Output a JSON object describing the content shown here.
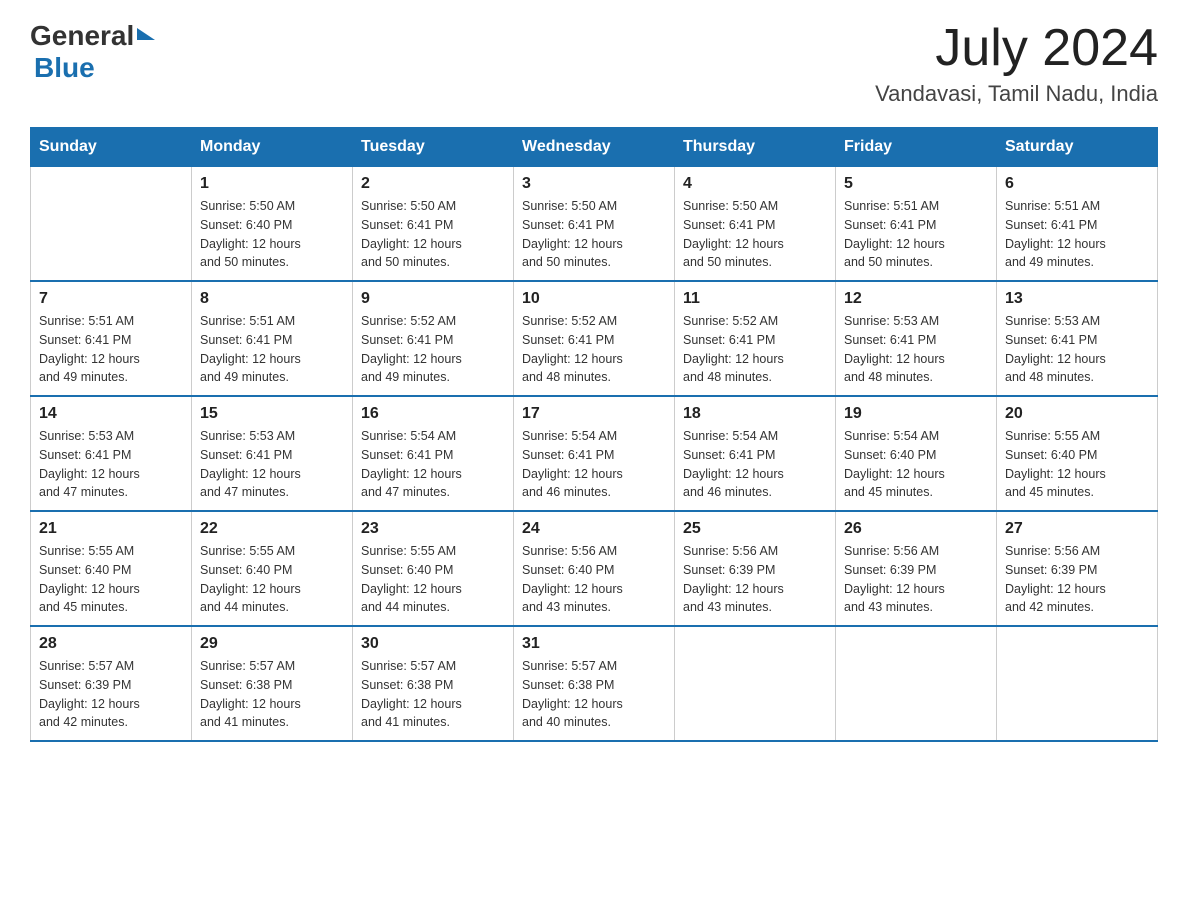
{
  "header": {
    "logo_general": "General",
    "logo_blue": "Blue",
    "month_title": "July 2024",
    "location": "Vandavasi, Tamil Nadu, India"
  },
  "calendar": {
    "days_of_week": [
      "Sunday",
      "Monday",
      "Tuesday",
      "Wednesday",
      "Thursday",
      "Friday",
      "Saturday"
    ],
    "weeks": [
      [
        {
          "day": "",
          "info": ""
        },
        {
          "day": "1",
          "info": "Sunrise: 5:50 AM\nSunset: 6:40 PM\nDaylight: 12 hours\nand 50 minutes."
        },
        {
          "day": "2",
          "info": "Sunrise: 5:50 AM\nSunset: 6:41 PM\nDaylight: 12 hours\nand 50 minutes."
        },
        {
          "day": "3",
          "info": "Sunrise: 5:50 AM\nSunset: 6:41 PM\nDaylight: 12 hours\nand 50 minutes."
        },
        {
          "day": "4",
          "info": "Sunrise: 5:50 AM\nSunset: 6:41 PM\nDaylight: 12 hours\nand 50 minutes."
        },
        {
          "day": "5",
          "info": "Sunrise: 5:51 AM\nSunset: 6:41 PM\nDaylight: 12 hours\nand 50 minutes."
        },
        {
          "day": "6",
          "info": "Sunrise: 5:51 AM\nSunset: 6:41 PM\nDaylight: 12 hours\nand 49 minutes."
        }
      ],
      [
        {
          "day": "7",
          "info": "Sunrise: 5:51 AM\nSunset: 6:41 PM\nDaylight: 12 hours\nand 49 minutes."
        },
        {
          "day": "8",
          "info": "Sunrise: 5:51 AM\nSunset: 6:41 PM\nDaylight: 12 hours\nand 49 minutes."
        },
        {
          "day": "9",
          "info": "Sunrise: 5:52 AM\nSunset: 6:41 PM\nDaylight: 12 hours\nand 49 minutes."
        },
        {
          "day": "10",
          "info": "Sunrise: 5:52 AM\nSunset: 6:41 PM\nDaylight: 12 hours\nand 48 minutes."
        },
        {
          "day": "11",
          "info": "Sunrise: 5:52 AM\nSunset: 6:41 PM\nDaylight: 12 hours\nand 48 minutes."
        },
        {
          "day": "12",
          "info": "Sunrise: 5:53 AM\nSunset: 6:41 PM\nDaylight: 12 hours\nand 48 minutes."
        },
        {
          "day": "13",
          "info": "Sunrise: 5:53 AM\nSunset: 6:41 PM\nDaylight: 12 hours\nand 48 minutes."
        }
      ],
      [
        {
          "day": "14",
          "info": "Sunrise: 5:53 AM\nSunset: 6:41 PM\nDaylight: 12 hours\nand 47 minutes."
        },
        {
          "day": "15",
          "info": "Sunrise: 5:53 AM\nSunset: 6:41 PM\nDaylight: 12 hours\nand 47 minutes."
        },
        {
          "day": "16",
          "info": "Sunrise: 5:54 AM\nSunset: 6:41 PM\nDaylight: 12 hours\nand 47 minutes."
        },
        {
          "day": "17",
          "info": "Sunrise: 5:54 AM\nSunset: 6:41 PM\nDaylight: 12 hours\nand 46 minutes."
        },
        {
          "day": "18",
          "info": "Sunrise: 5:54 AM\nSunset: 6:41 PM\nDaylight: 12 hours\nand 46 minutes."
        },
        {
          "day": "19",
          "info": "Sunrise: 5:54 AM\nSunset: 6:40 PM\nDaylight: 12 hours\nand 45 minutes."
        },
        {
          "day": "20",
          "info": "Sunrise: 5:55 AM\nSunset: 6:40 PM\nDaylight: 12 hours\nand 45 minutes."
        }
      ],
      [
        {
          "day": "21",
          "info": "Sunrise: 5:55 AM\nSunset: 6:40 PM\nDaylight: 12 hours\nand 45 minutes."
        },
        {
          "day": "22",
          "info": "Sunrise: 5:55 AM\nSunset: 6:40 PM\nDaylight: 12 hours\nand 44 minutes."
        },
        {
          "day": "23",
          "info": "Sunrise: 5:55 AM\nSunset: 6:40 PM\nDaylight: 12 hours\nand 44 minutes."
        },
        {
          "day": "24",
          "info": "Sunrise: 5:56 AM\nSunset: 6:40 PM\nDaylight: 12 hours\nand 43 minutes."
        },
        {
          "day": "25",
          "info": "Sunrise: 5:56 AM\nSunset: 6:39 PM\nDaylight: 12 hours\nand 43 minutes."
        },
        {
          "day": "26",
          "info": "Sunrise: 5:56 AM\nSunset: 6:39 PM\nDaylight: 12 hours\nand 43 minutes."
        },
        {
          "day": "27",
          "info": "Sunrise: 5:56 AM\nSunset: 6:39 PM\nDaylight: 12 hours\nand 42 minutes."
        }
      ],
      [
        {
          "day": "28",
          "info": "Sunrise: 5:57 AM\nSunset: 6:39 PM\nDaylight: 12 hours\nand 42 minutes."
        },
        {
          "day": "29",
          "info": "Sunrise: 5:57 AM\nSunset: 6:38 PM\nDaylight: 12 hours\nand 41 minutes."
        },
        {
          "day": "30",
          "info": "Sunrise: 5:57 AM\nSunset: 6:38 PM\nDaylight: 12 hours\nand 41 minutes."
        },
        {
          "day": "31",
          "info": "Sunrise: 5:57 AM\nSunset: 6:38 PM\nDaylight: 12 hours\nand 40 minutes."
        },
        {
          "day": "",
          "info": ""
        },
        {
          "day": "",
          "info": ""
        },
        {
          "day": "",
          "info": ""
        }
      ]
    ]
  }
}
